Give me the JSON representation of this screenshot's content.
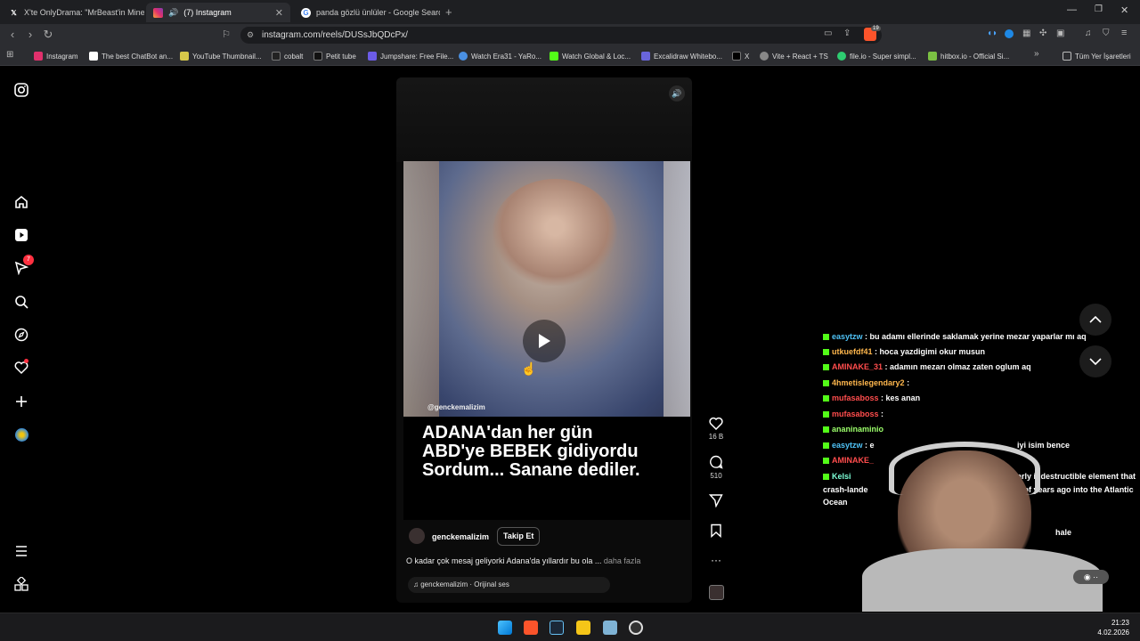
{
  "browser": {
    "tabs": [
      {
        "title": "X'te OnlyDrama: \"MrBeast'in Minecra",
        "favicon": "x-icon"
      },
      {
        "title": "(7) Instagram",
        "favicon": "instagram-icon",
        "active": true
      },
      {
        "title": "panda gözlü ünlüler - Google Search",
        "favicon": "google-icon"
      }
    ],
    "url": "instagram.com/reels/DUSsJbQDcPx/",
    "bookmarks": [
      "Instagram",
      "The best ChatBot an...",
      "YouTube Thumbnail...",
      "cobalt",
      "Petit tube",
      "Jumpshare: Free File...",
      "Watch Era31 - YaRo...",
      "Watch Global & Loc...",
      "Excalidraw Whitebo...",
      "X",
      "Vite + React + TS",
      "file.io - Super simpl...",
      "hitbox.io - Official Si..."
    ],
    "all_bookmarks_label": "Tüm Yer İşaretleri",
    "brave_badge": "19"
  },
  "instagram": {
    "notification_count": "7",
    "reel": {
      "watermark": "@genckemalizim",
      "caption_lines": [
        "ADANA'dan her gün",
        "ABD'ye BEBEK gidiyordu",
        "Sordum... Sanane dediler."
      ],
      "username": "genckemalizim",
      "follow_label": "Takip Et",
      "description": "O kadar çok mesaj geliyorki Adana'da yıllardır bu ola ...",
      "more_label": "daha fazla",
      "audio": "genckemalizim · Orijinal ses",
      "likes": "16 B",
      "comments": "510"
    }
  },
  "chat": [
    {
      "user": "easytzw",
      "color": "#4fc3f7",
      "msg": ": bu adamı ellerinde saklamak yerine mezar yaparlar mı aq"
    },
    {
      "user": "utkuefdf41",
      "color": "#ffb74d",
      "msg": ": hoca yazdigimi okur musun"
    },
    {
      "user": "AMINAKE_31",
      "color": "#ff4d4d",
      "msg": ": adamın mezarı olmaz zaten oglum aq"
    },
    {
      "user": "4hmetislegendary2",
      "color": "#ffb74d",
      "msg": ":"
    },
    {
      "user": "mufasaboss",
      "color": "#ff4d4d",
      "msg": ": kes anan"
    },
    {
      "user": "mufasaboss",
      "color": "#ff4d4d",
      "msg": ":"
    },
    {
      "user": "ananinaminio",
      "color": "#9cff6b",
      "msg": ""
    },
    {
      "user": "easytzw",
      "color": "#4fc3f7",
      "msg": ": e"
    },
    {
      "user": "AMINAKE_",
      "color": "#ff4d4d",
      "msg": ""
    },
    {
      "user": "Kelsi",
      "color": "#7dffd8",
      "msg": ""
    }
  ],
  "chat_fragments": {
    "f1": "iyi isim bence",
    "f2": "arly indestructible element that",
    "f3": "crash-lande",
    "f4": "s of years ago into the Atlantic",
    "f5": "Ocean",
    "f6": "hale"
  },
  "taskbar": {
    "time": "21:23",
    "date": "4.02.2026"
  },
  "colors": {
    "instagram_red": "#ff3040",
    "chat_green": "#53fc18"
  }
}
